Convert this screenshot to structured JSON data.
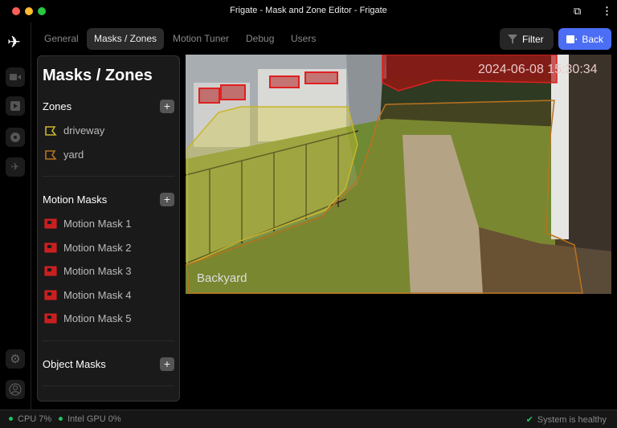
{
  "window": {
    "title": "Frigate - Mask and Zone Editor - Frigate"
  },
  "tabs": [
    {
      "label": "General"
    },
    {
      "label": "Masks / Zones"
    },
    {
      "label": "Motion Tuner"
    },
    {
      "label": "Debug"
    },
    {
      "label": "Users"
    }
  ],
  "toolbar": {
    "filter_label": "Filter",
    "back_label": "Back"
  },
  "panel": {
    "title": "Masks / Zones",
    "zones": {
      "label": "Zones",
      "items": [
        {
          "label": "driveway",
          "color": "#c9b52a"
        },
        {
          "label": "yard",
          "color": "#b8731f"
        }
      ]
    },
    "motion_masks": {
      "label": "Motion Masks",
      "items": [
        {
          "label": "Motion Mask 1"
        },
        {
          "label": "Motion Mask 2"
        },
        {
          "label": "Motion Mask 3"
        },
        {
          "label": "Motion Mask 4"
        },
        {
          "label": "Motion Mask 5"
        }
      ]
    },
    "object_masks": {
      "label": "Object Masks"
    },
    "add_symbol": "+"
  },
  "camera": {
    "name": "Backyard",
    "timestamp": "2024-06-08 15:30:34"
  },
  "status": {
    "cpu": "CPU 7%",
    "gpu": "Intel GPU 0%",
    "health": "System is healthy"
  },
  "colors": {
    "accent": "#4b6ef5",
    "mask": "#e02020",
    "ok": "#22c55e"
  }
}
